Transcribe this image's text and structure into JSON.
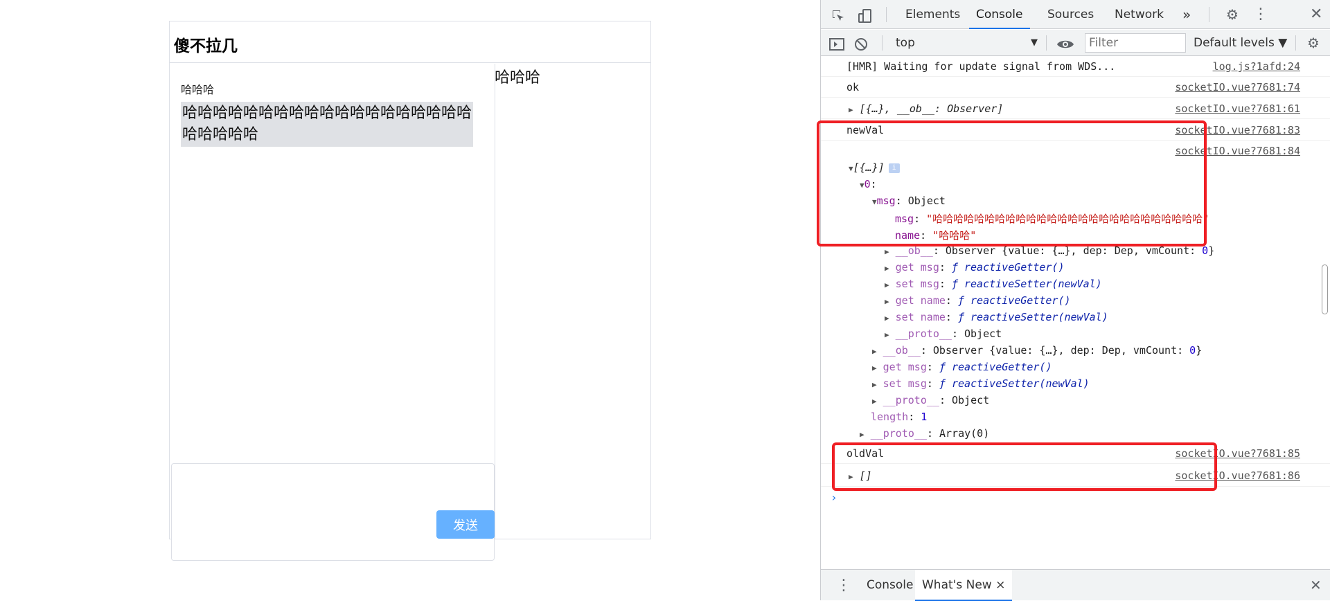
{
  "app": {
    "title": "傻不拉几",
    "message": {
      "name": "哈哈哈",
      "text": "哈哈哈哈哈哈哈哈哈哈哈哈哈哈哈哈哈哈哈哈哈哈哈哈"
    },
    "send_label": "发送",
    "user_panel_text": "哈哈哈"
  },
  "devtools": {
    "tabs": [
      "Elements",
      "Console",
      "Sources",
      "Network"
    ],
    "more_tabs": "»",
    "context": "top",
    "filter_placeholder": "Filter",
    "levels": "Default levels ▼",
    "logs": [
      {
        "text": "[HMR] Waiting for update signal from WDS...",
        "src": "log.js?1afd:24"
      },
      {
        "text": "ok",
        "src": "socketIO.vue?7681:74"
      },
      {
        "text": "[{…}, __ob__: Observer]",
        "src": "socketIO.vue?7681:61"
      },
      {
        "text": "newVal",
        "src": "socketIO.vue?7681:83"
      },
      {
        "text": "",
        "src": "socketIO.vue?7681:84"
      },
      {
        "text": "oldVal",
        "src": "socketIO.vue?7681:85"
      },
      {
        "text": "[]",
        "src": "socketIO.vue?7681:86"
      }
    ],
    "tree": {
      "root": "[{…}]",
      "index": "0",
      "msg_key": "msg",
      "object_label": "Object",
      "inner_msg_key": "msg",
      "inner_msg_value": "\"哈哈哈哈哈哈哈哈哈哈哈哈哈哈哈哈哈哈哈哈哈哈哈哈哈哈\"",
      "inner_name_key": "name",
      "inner_name_value": "\"哈哈哈\"",
      "ob_key": "__ob__",
      "ob_value": "Observer {value: {…}, dep: Dep, vmCount: ",
      "vm_count": "0",
      "get_msg": "get msg",
      "set_msg": "set msg",
      "get_name": "get name",
      "set_name": "set name",
      "getter_fn": "ƒ reactiveGetter()",
      "setter_fn": "ƒ reactiveSetter(newVal)",
      "proto_key": "__proto__",
      "length_key": "length",
      "length_value": "1",
      "array_proto_value": "Array(0)"
    },
    "drawer": {
      "console": "Console",
      "whats_new": "What's New",
      "close": "×"
    }
  }
}
